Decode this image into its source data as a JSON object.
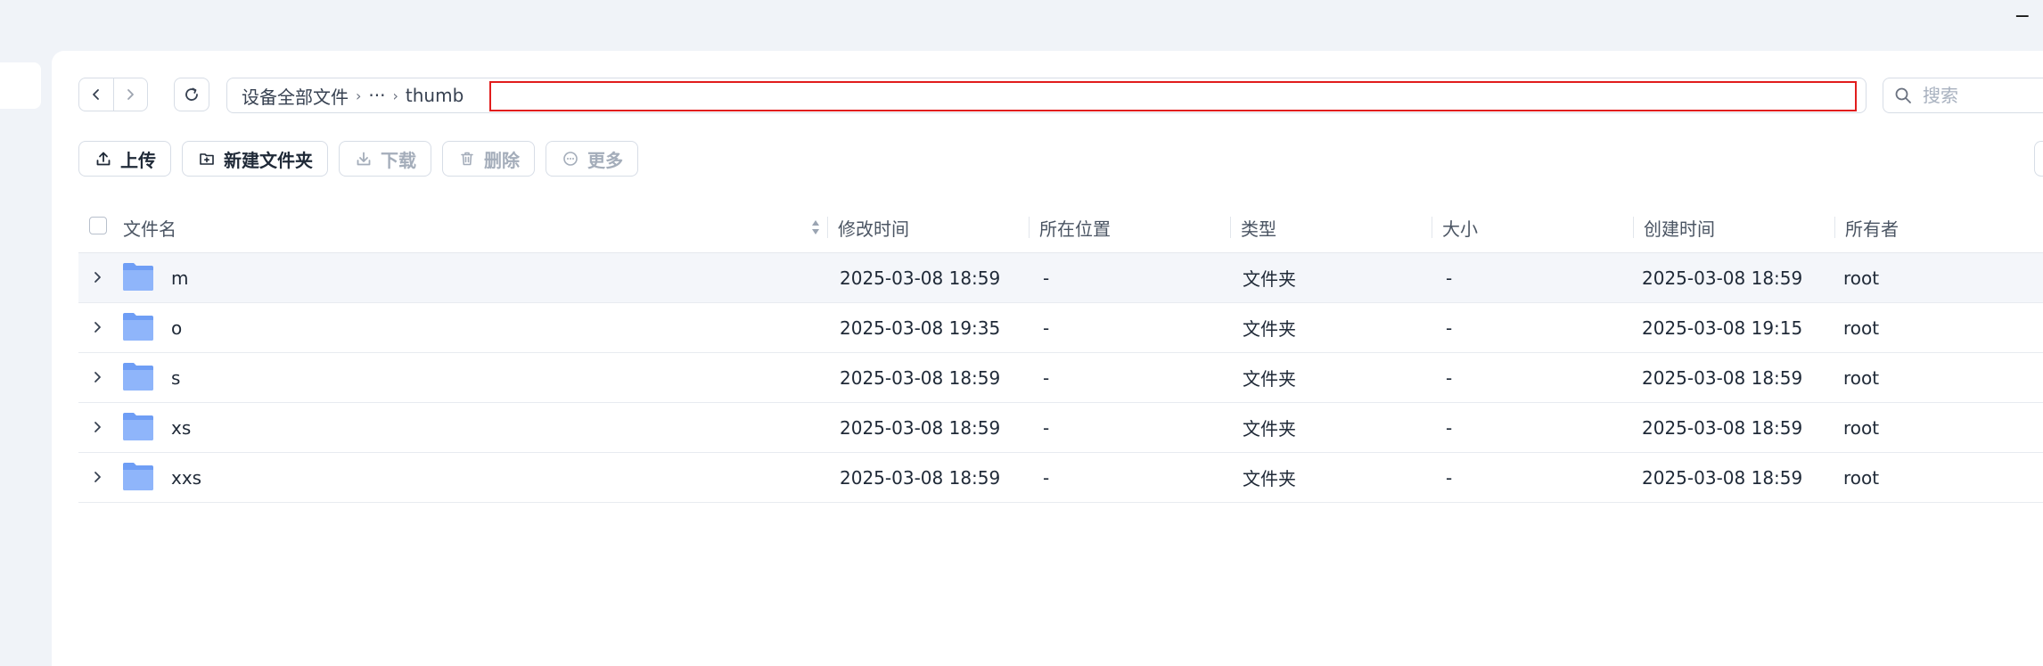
{
  "window": {
    "minimize_glyph": "−"
  },
  "nav": {
    "back_icon": "chevron-left-icon",
    "forward_icon": "chevron-right-icon",
    "refresh_icon": "refresh-icon"
  },
  "path": {
    "root": "设备全部文件",
    "ellipsis": "···",
    "current": "thumb",
    "separator": "›",
    "edit_value": ""
  },
  "search": {
    "placeholder": "搜索"
  },
  "toolbar": {
    "upload": "上传",
    "new_folder": "新建文件夹",
    "download": "下载",
    "delete": "删除",
    "more": "更多"
  },
  "table": {
    "headers": {
      "name": "文件名",
      "modified": "修改时间",
      "location": "所在位置",
      "type": "类型",
      "size": "大小",
      "created": "创建时间",
      "owner": "所有者"
    },
    "rows": [
      {
        "name": "m",
        "modified": "2025-03-08 18:59",
        "location": "-",
        "type": "文件夹",
        "size": "-",
        "created": "2025-03-08 18:59",
        "owner": "root"
      },
      {
        "name": "o",
        "modified": "2025-03-08 19:35",
        "location": "-",
        "type": "文件夹",
        "size": "-",
        "created": "2025-03-08 19:15",
        "owner": "root"
      },
      {
        "name": "s",
        "modified": "2025-03-08 18:59",
        "location": "-",
        "type": "文件夹",
        "size": "-",
        "created": "2025-03-08 18:59",
        "owner": "root"
      },
      {
        "name": "xs",
        "modified": "2025-03-08 18:59",
        "location": "-",
        "type": "文件夹",
        "size": "-",
        "created": "2025-03-08 18:59",
        "owner": "root"
      },
      {
        "name": "xxs",
        "modified": "2025-03-08 18:59",
        "location": "-",
        "type": "文件夹",
        "size": "-",
        "created": "2025-03-08 18:59",
        "owner": "root"
      }
    ]
  },
  "colors": {
    "accent_border": "#e11d1d",
    "folder": "#6f9ef5",
    "background": "#f0f3f8"
  }
}
